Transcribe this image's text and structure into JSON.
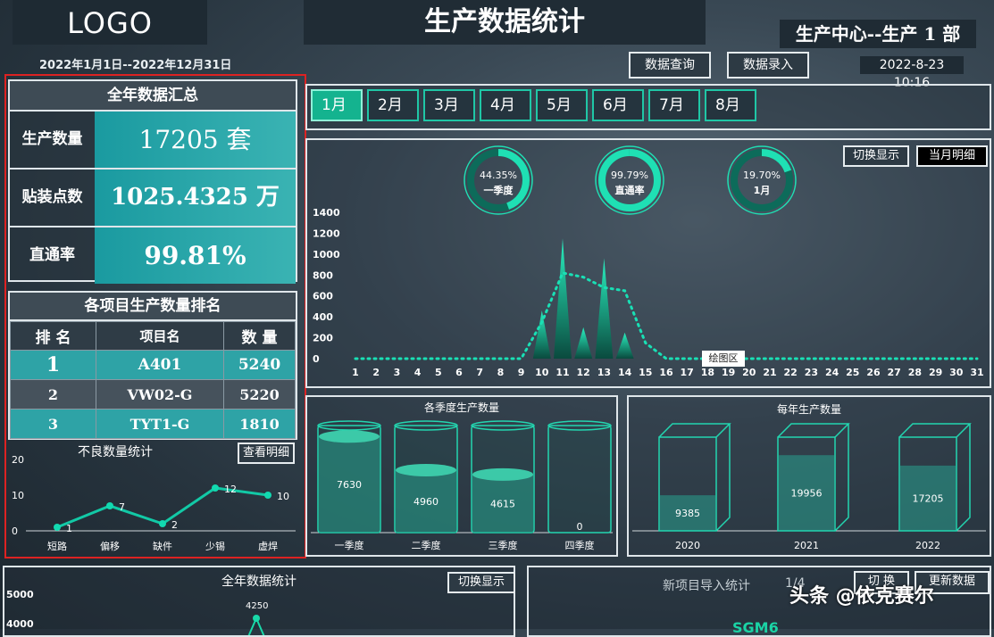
{
  "header": {
    "logo": "LOGO",
    "title": "生产数据统计",
    "department": "生产中心--生产 1 部",
    "date_range": "2022年1月1日--2022年12月31日",
    "query_button": "数据查询",
    "entry_button": "数据录入",
    "datetime": "2022-8-23 10:16"
  },
  "summary": {
    "title": "全年数据汇总",
    "rows": [
      {
        "label": "生产数量",
        "value": "17205 套"
      },
      {
        "label": "贴装点数",
        "value": "1025.4325 万"
      },
      {
        "label": "直通率",
        "value": "99.81%"
      }
    ]
  },
  "ranking": {
    "title": "各项目生产数量排名",
    "headers": [
      "排 名",
      "项目名",
      "数 量"
    ],
    "rows": [
      {
        "rank": "1",
        "name": "A401",
        "qty": "5240"
      },
      {
        "rank": "2",
        "name": "VW02-G",
        "qty": "5220"
      },
      {
        "rank": "3",
        "name": "TYT1-G",
        "qty": "1810"
      }
    ]
  },
  "defects": {
    "title": "不良数量统计",
    "detail_button": "查看明细",
    "chart_data": {
      "type": "line",
      "categories": [
        "短路",
        "偏移",
        "缺件",
        "少锡",
        "虚焊"
      ],
      "values": [
        1,
        7,
        2,
        12,
        10
      ],
      "ylim": [
        0,
        20
      ],
      "yticks": [
        0,
        10,
        20
      ]
    }
  },
  "months": {
    "items": [
      "1月",
      "2月",
      "3月",
      "4月",
      "5月",
      "6月",
      "7月",
      "8月"
    ],
    "active_index": 0
  },
  "daily": {
    "toggle_button": "切换显示",
    "month_detail_button": "当月明细",
    "plot_area_label": "绘图区",
    "rings": [
      {
        "value": "44.35%",
        "label": "一季度",
        "fraction": 0.4435
      },
      {
        "value": "99.79%",
        "label": "直通率",
        "fraction": 0.9979
      },
      {
        "value": "19.70%",
        "label": "1月",
        "fraction": 0.197
      }
    ],
    "chart_data": {
      "type": "area",
      "x": [
        1,
        2,
        3,
        4,
        5,
        6,
        7,
        8,
        9,
        10,
        11,
        12,
        13,
        14,
        15,
        16,
        17,
        18,
        19,
        20,
        21,
        22,
        23,
        24,
        25,
        26,
        27,
        28,
        29,
        30,
        31
      ],
      "series": [
        {
          "values": [
            0,
            0,
            0,
            0,
            0,
            0,
            0,
            0,
            0,
            460,
            1150,
            300,
            960,
            250,
            0,
            0,
            0,
            0,
            0,
            0,
            0,
            0,
            0,
            0,
            0,
            0,
            0,
            0,
            0,
            0,
            0
          ]
        },
        {
          "values": [
            0,
            0,
            0,
            0,
            0,
            0,
            0,
            0,
            0,
            350,
            820,
            780,
            680,
            650,
            150,
            0,
            0,
            0,
            0,
            0,
            0,
            0,
            0,
            0,
            0,
            0,
            0,
            0,
            0,
            0,
            0
          ]
        }
      ],
      "ylim": [
        0,
        1400
      ],
      "yticks": [
        0,
        200,
        400,
        600,
        800,
        1000,
        1200,
        1400
      ]
    }
  },
  "quarterly": {
    "title": "各季度生产数量",
    "chart_data": {
      "type": "bar",
      "categories": [
        "一季度",
        "二季度",
        "三季度",
        "四季度"
      ],
      "values": [
        7630,
        4960,
        4615,
        0
      ],
      "ylim": [
        0,
        8500
      ]
    }
  },
  "yearly": {
    "title": "每年生产数量",
    "chart_data": {
      "type": "bar",
      "categories": [
        "2020",
        "2021",
        "2022"
      ],
      "values": [
        9385,
        19956,
        17205
      ],
      "ylim": [
        0,
        24000
      ]
    }
  },
  "annual": {
    "title": "全年数据统计",
    "toggle_button": "切换显示",
    "chart_data": {
      "type": "line",
      "yticks_visible": [
        "5000",
        "4000"
      ],
      "point_label": "4250"
    }
  },
  "new_projects": {
    "title": "新项目导入统计",
    "pager": "1/4",
    "switch_button": "切 换",
    "update_button": "更新数据",
    "project_name": "SGM6"
  },
  "watermark": "头条 @依克赛尔"
}
